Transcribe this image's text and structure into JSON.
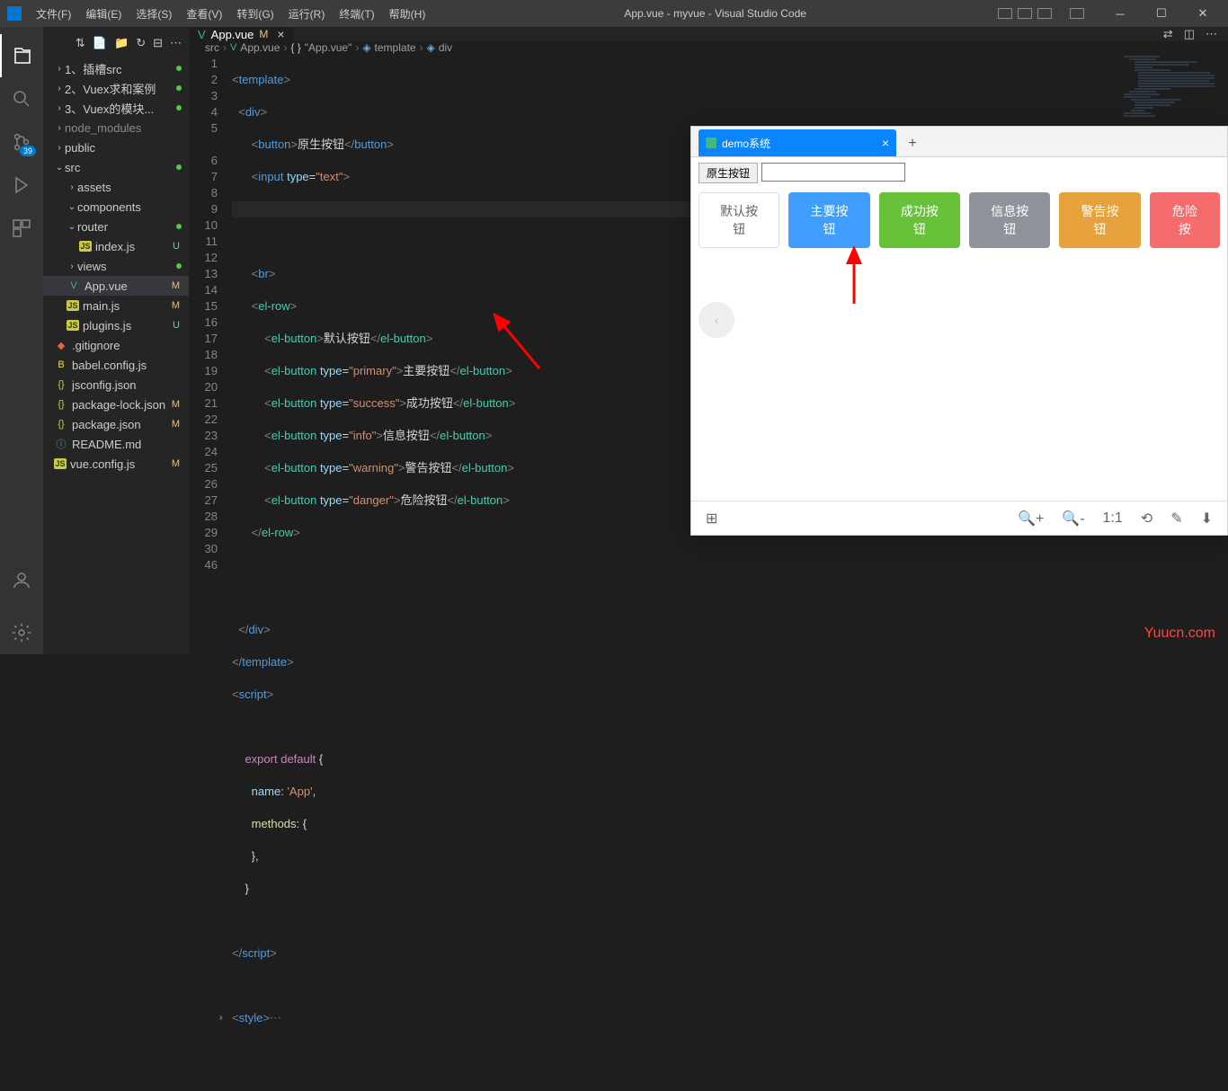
{
  "window": {
    "title": "App.vue - myvue - Visual Studio Code"
  },
  "menus": [
    "文件(F)",
    "编辑(E)",
    "选择(S)",
    "查看(V)",
    "转到(G)",
    "运行(R)",
    "终端(T)",
    "帮助(H)"
  ],
  "activity": {
    "scm_badge": "39"
  },
  "sidebar": {
    "folders": {
      "f1": "1、插槽src",
      "f2": "2、Vuex求和案例",
      "f3": "3、Vuex的模块...",
      "node": "node_modules",
      "public": "public",
      "src": "src",
      "assets": "assets",
      "components": "components",
      "router": "router",
      "indexjs": "index.js",
      "views": "views",
      "appvue": "App.vue",
      "mainjs": "main.js",
      "pluginsjs": "plugins.js",
      "gitignore": ".gitignore",
      "babel": "babel.config.js",
      "jsconfig": "jsconfig.json",
      "pkglock": "package-lock.json",
      "pkg": "package.json",
      "readme": "README.md",
      "vuecfg": "vue.config.js"
    },
    "status": {
      "U": "U",
      "M": "M"
    }
  },
  "tab": {
    "name": "App.vue",
    "modified": "M"
  },
  "breadcrumbs": {
    "src": "src",
    "app": "App.vue",
    "app2": "\"App.vue\"",
    "template": "template",
    "div": "div"
  },
  "code": {
    "lines": [
      "1",
      "2",
      "3",
      "4",
      "5",
      "",
      "6",
      "7",
      "8",
      "9",
      "10",
      "11",
      "12",
      "13",
      "14",
      "15",
      "16",
      "17",
      "18",
      "19",
      "20",
      "21",
      "22",
      "23",
      "24",
      "25",
      "26",
      "27",
      "28",
      "29",
      "30",
      "46"
    ],
    "button_text": "原生按钮",
    "input_type": "text",
    "default_btn": "默认按钮",
    "primary": "primary",
    "primary_btn": "主要按钮",
    "success": "success",
    "success_btn": "成功按钮",
    "info": "info",
    "info_btn": "信息按钮",
    "warning": "warning",
    "warning_btn": "警告按钮",
    "danger": "danger",
    "danger_btn": "危险按钮",
    "export_default": "export default",
    "name_key": "name",
    "name_val": "'App'",
    "methods_key": "methods",
    "style_tag": "style"
  },
  "preview": {
    "tab_title": "demo系统",
    "native_btn": "原生按钮",
    "btns": {
      "default": "默认按钮",
      "primary": "主要按钮",
      "success": "成功按钮",
      "info": "信息按钮",
      "warning": "警告按钮",
      "danger": "危险按"
    }
  },
  "watermark": "Yuucn.com"
}
